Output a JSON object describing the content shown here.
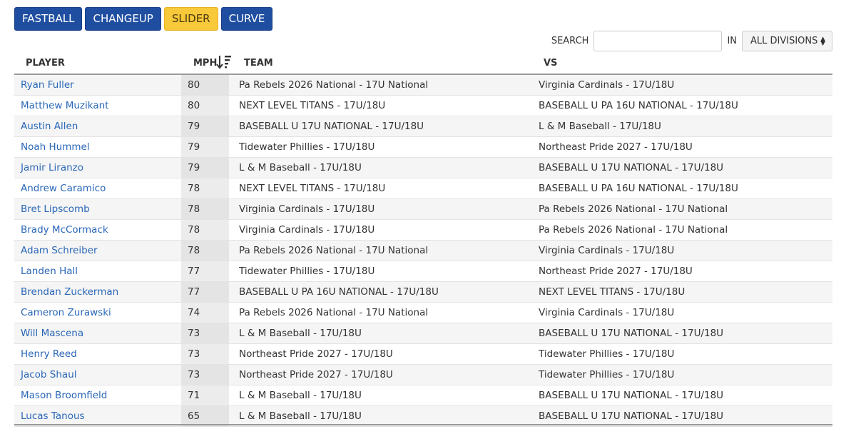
{
  "tabs": [
    {
      "label": "FASTBALL",
      "active": false
    },
    {
      "label": "CHANGEUP",
      "active": false
    },
    {
      "label": "SLIDER",
      "active": true
    },
    {
      "label": "CURVE",
      "active": false
    }
  ],
  "search": {
    "label": "SEARCH",
    "value": "",
    "in_label": "IN",
    "division": "ALL DIVISIONS"
  },
  "table": {
    "headers": {
      "player": "PLAYER",
      "mph": "MPH",
      "team": "TEAM",
      "vs": "VS"
    },
    "sort": {
      "column": "mph",
      "direction": "descending"
    },
    "rows": [
      {
        "player": "Ryan Fuller",
        "mph": "80",
        "team": "Pa Rebels 2026 National - 17U National",
        "vs": "Virginia Cardinals - 17U/18U"
      },
      {
        "player": "Matthew Muzikant",
        "mph": "80",
        "team": "NEXT LEVEL TITANS - 17U/18U",
        "vs": "BASEBALL U PA 16U NATIONAL - 17U/18U"
      },
      {
        "player": "Austin Allen",
        "mph": "79",
        "team": "BASEBALL U 17U NATIONAL - 17U/18U",
        "vs": "L & M Baseball - 17U/18U"
      },
      {
        "player": "Noah Hummel",
        "mph": "79",
        "team": "Tidewater Phillies - 17U/18U",
        "vs": "Northeast Pride 2027 - 17U/18U"
      },
      {
        "player": "Jamir Liranzo",
        "mph": "79",
        "team": "L & M Baseball - 17U/18U",
        "vs": "BASEBALL U 17U NATIONAL - 17U/18U"
      },
      {
        "player": "Andrew Caramico",
        "mph": "78",
        "team": "NEXT LEVEL TITANS - 17U/18U",
        "vs": "BASEBALL U PA 16U NATIONAL - 17U/18U"
      },
      {
        "player": "Bret Lipscomb",
        "mph": "78",
        "team": "Virginia Cardinals - 17U/18U",
        "vs": "Pa Rebels 2026 National - 17U National"
      },
      {
        "player": "Brady McCormack",
        "mph": "78",
        "team": "Virginia Cardinals - 17U/18U",
        "vs": "Pa Rebels 2026 National - 17U National"
      },
      {
        "player": "Adam Schreiber",
        "mph": "78",
        "team": "Pa Rebels 2026 National - 17U National",
        "vs": "Virginia Cardinals - 17U/18U"
      },
      {
        "player": "Landen Hall",
        "mph": "77",
        "team": "Tidewater Phillies - 17U/18U",
        "vs": "Northeast Pride 2027 - 17U/18U"
      },
      {
        "player": "Brendan Zuckerman",
        "mph": "77",
        "team": "BASEBALL U PA 16U NATIONAL - 17U/18U",
        "vs": "NEXT LEVEL TITANS - 17U/18U"
      },
      {
        "player": "Cameron Zurawski",
        "mph": "74",
        "team": "Pa Rebels 2026 National - 17U National",
        "vs": "Virginia Cardinals - 17U/18U"
      },
      {
        "player": "Will Mascena",
        "mph": "73",
        "team": "L & M Baseball - 17U/18U",
        "vs": "BASEBALL U 17U NATIONAL - 17U/18U"
      },
      {
        "player": "Henry Reed",
        "mph": "73",
        "team": "Northeast Pride 2027 - 17U/18U",
        "vs": "Tidewater Phillies - 17U/18U"
      },
      {
        "player": "Jacob Shaul",
        "mph": "73",
        "team": "Northeast Pride 2027 - 17U/18U",
        "vs": "Tidewater Phillies - 17U/18U"
      },
      {
        "player": "Mason Broomfield",
        "mph": "71",
        "team": "L & M Baseball - 17U/18U",
        "vs": "BASEBALL U 17U NATIONAL - 17U/18U"
      },
      {
        "player": "Lucas Tanous",
        "mph": "65",
        "team": "L & M Baseball - 17U/18U",
        "vs": "BASEBALL U 17U NATIONAL - 17U/18U"
      }
    ]
  },
  "icons": {
    "sort": "sort-descending-icon",
    "select": "updown-caret-icon"
  },
  "colors": {
    "tab": "#1f4ea1",
    "tab_active": "#f8c93a",
    "link": "#2a67b8"
  }
}
